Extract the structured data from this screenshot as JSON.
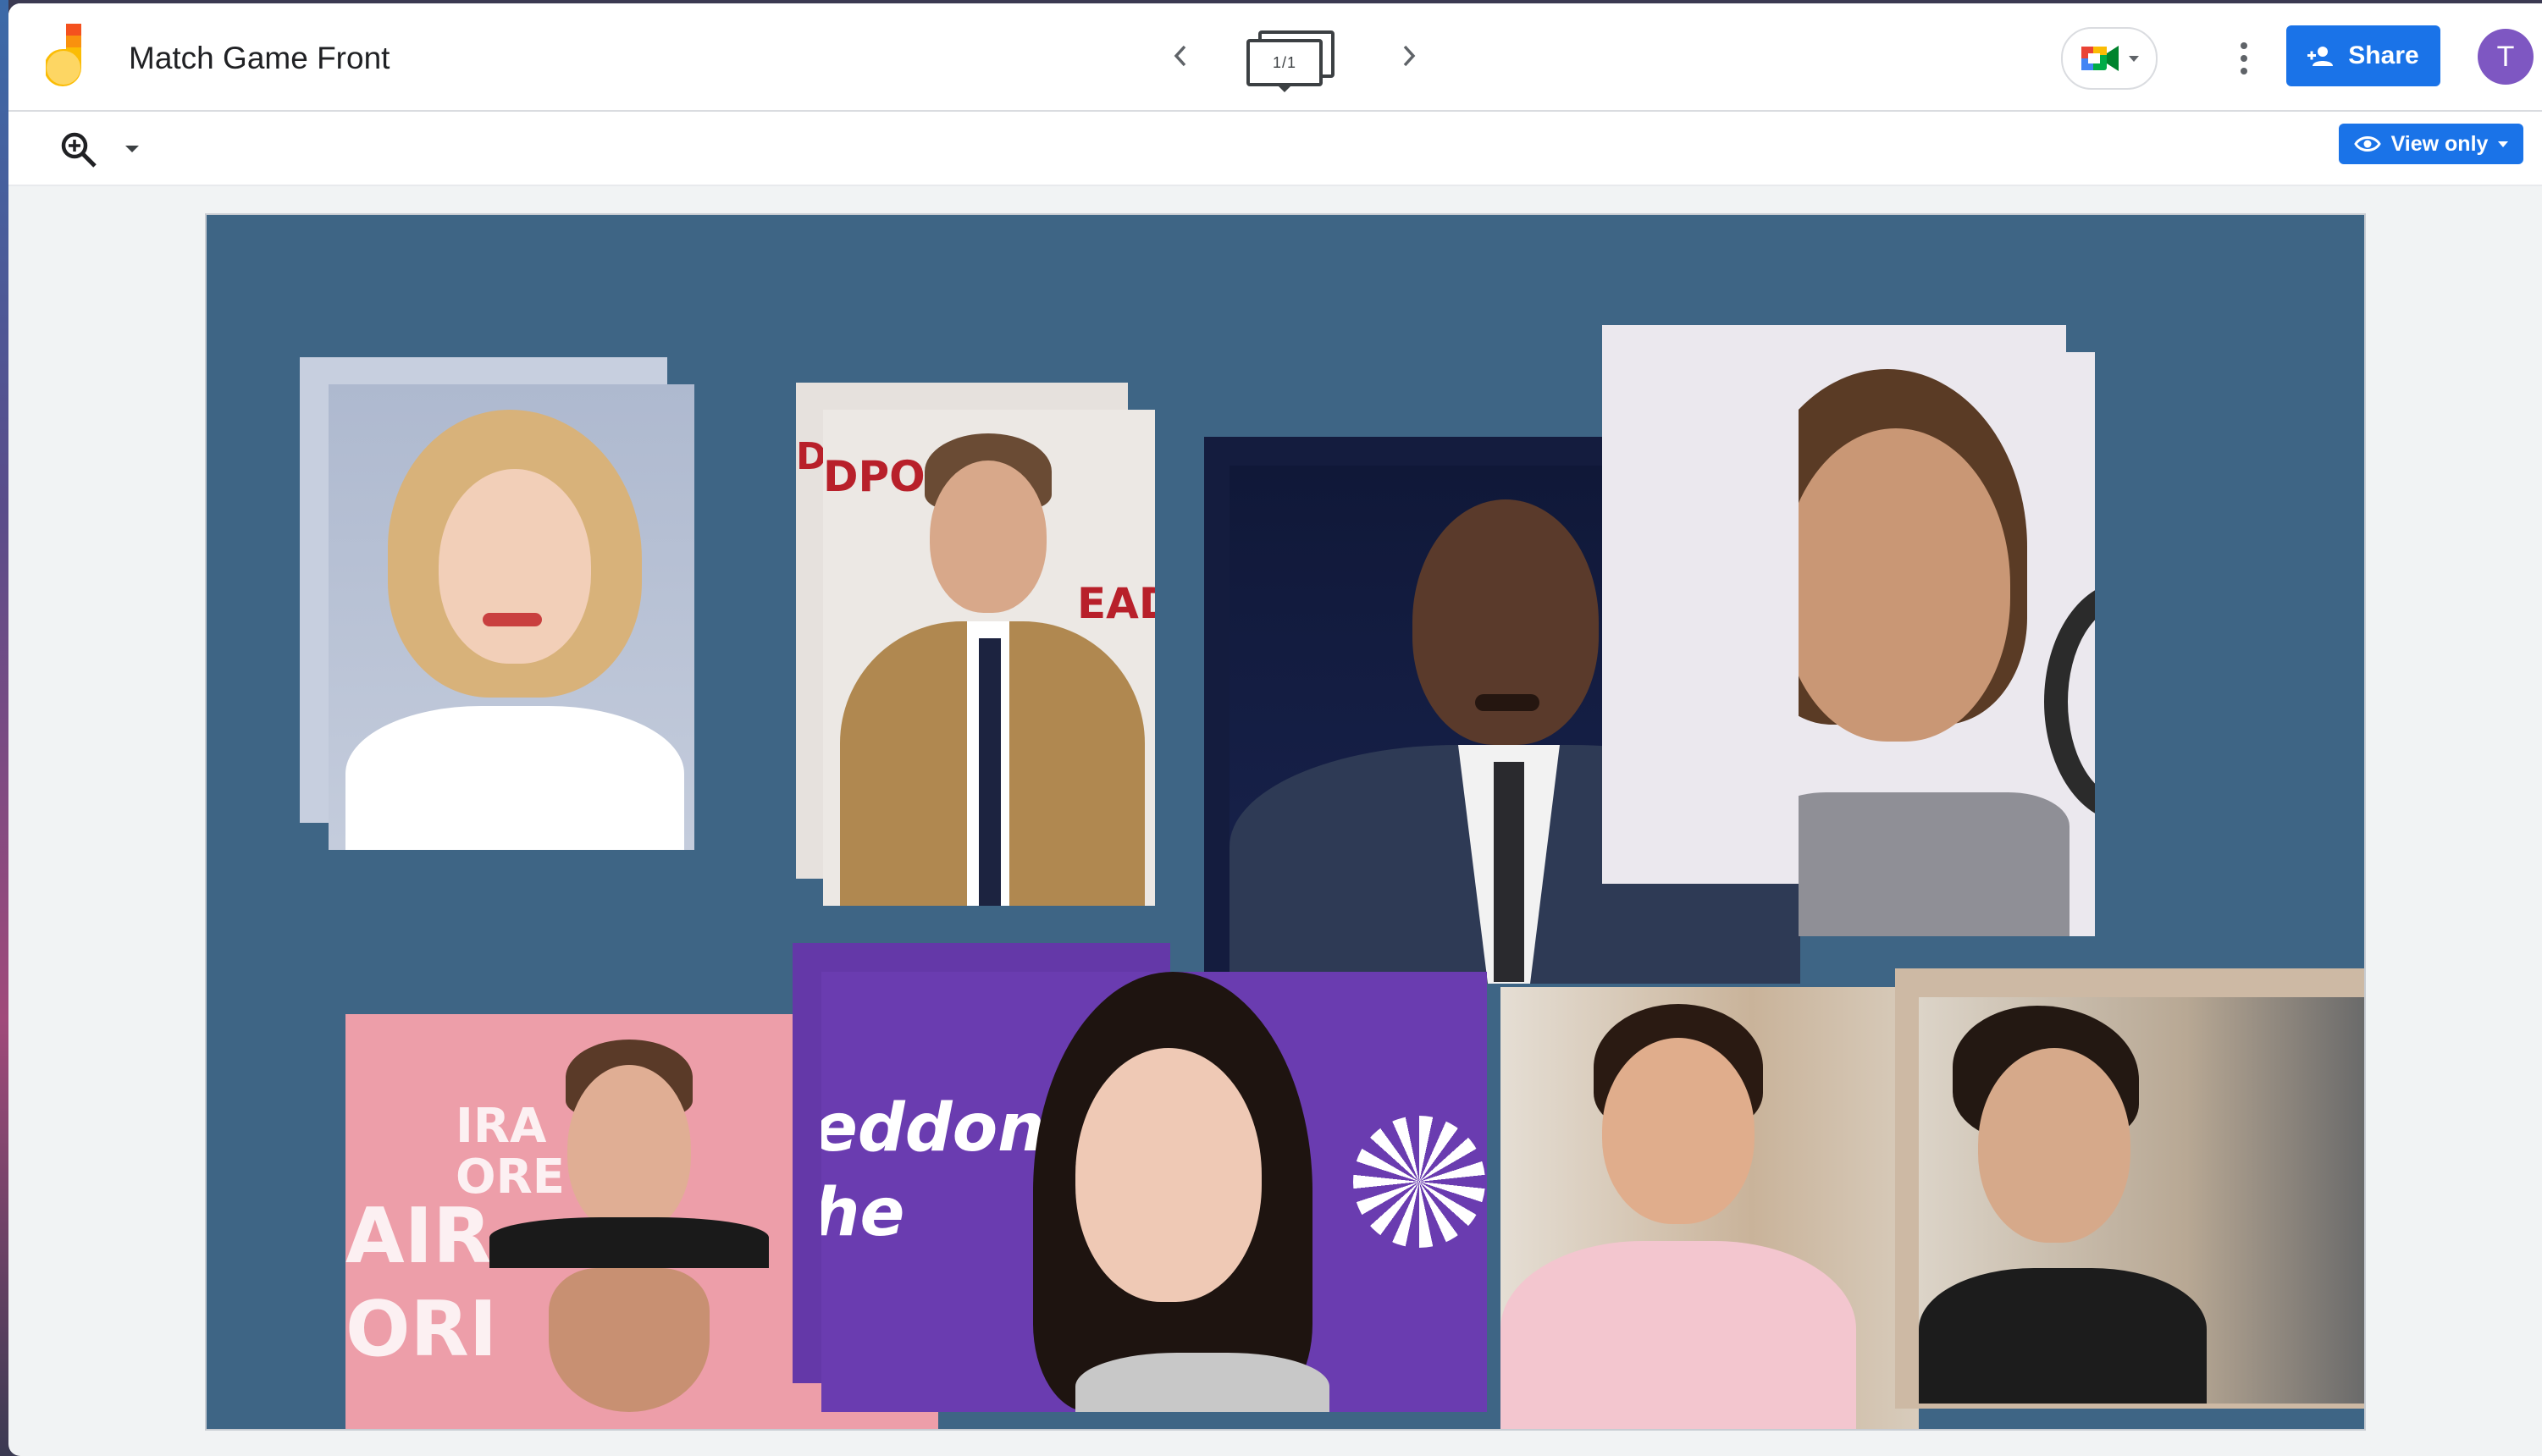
{
  "app": {
    "title": "Match Game Front",
    "page_indicator": "1/1",
    "share_label": "Share",
    "avatar_initial": "T",
    "view_mode_label": "View only"
  },
  "icons": {
    "logo": "jamboard-logo",
    "prev": "chevron-left-icon",
    "next": "chevron-right-icon",
    "meet": "meet-icon",
    "more": "more-vert-icon",
    "share": "person-add-icon",
    "zoom": "zoom-in-icon",
    "view": "eye-icon"
  },
  "colors": {
    "accent": "#1a73e8",
    "canvas_bg": "#3e6585",
    "avatar": "#7e57c2"
  },
  "canvas": {
    "photos": [
      {
        "name": "photo-woman-blonde-bob",
        "bg": "#b9c3d6",
        "skin": "#f1cdb6",
        "hair": "#d9b27a",
        "top": "#ffffff"
      },
      {
        "name": "photo-man-tan-suit",
        "bg": "#e9e4e0",
        "skin": "#d9a98a",
        "hair": "#6a4b34",
        "top": "#b08850"
      },
      {
        "name": "photo-man-navy-suit",
        "bg": "#121a3a",
        "skin": "#5a3a2b",
        "hair": "#3a2618",
        "top": "#2e3a55"
      },
      {
        "name": "photo-woman-earring-gala",
        "bg": "#e9e6ec",
        "skin": "#c99775",
        "hair": "#5a3b25",
        "top": "#9a9aa0"
      },
      {
        "name": "photo-man-pink-backdrop",
        "bg": "#ec9ea8",
        "skin": "#e2b096",
        "hair": "#5a3a28",
        "top": "#1a1a1a"
      },
      {
        "name": "photo-woman-purple-backdrop",
        "bg": "#6a3cb0",
        "skin": "#efc9b5",
        "hair": "#1e1410",
        "top": "#c8c8c8"
      },
      {
        "name": "photo-woman-pink-top",
        "bg": "#cdbba5",
        "skin": "#e0ad8c",
        "hair": "#2a1a12",
        "top": "#f3c6cf"
      },
      {
        "name": "photo-woman-short-hair",
        "bg": "#d9d1c6",
        "skin": "#d6a98a",
        "hair": "#231812",
        "top": "#1c1c1c"
      }
    ],
    "backdrop_text": {
      "pool": "DPOO",
      "deadp": "EADP",
      "ira": "IRA",
      "ore": "ORE",
      "air": "AIR",
      "ori": "ORI",
      "eddon": "eddon",
      "he": "he"
    }
  }
}
